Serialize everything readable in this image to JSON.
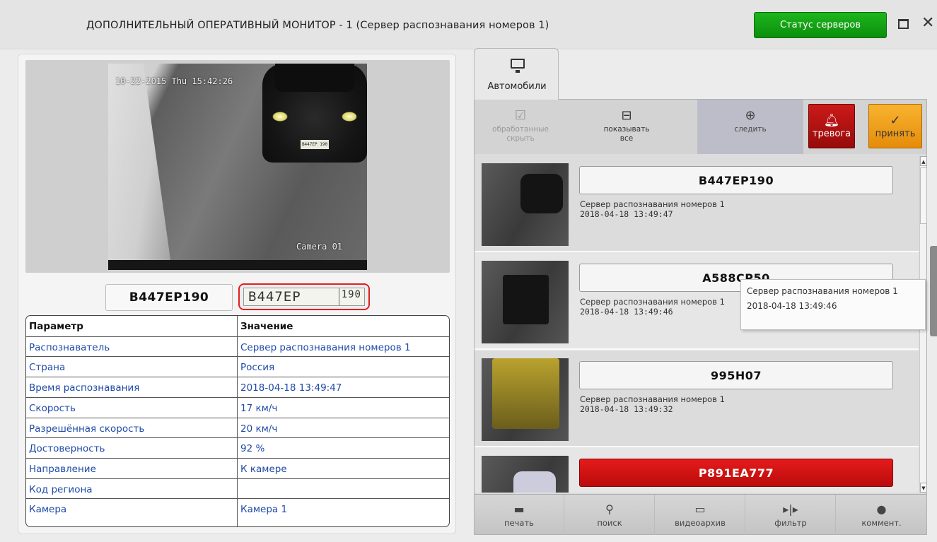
{
  "window": {
    "title": "ДОПОЛНИТЕЛЬНЫЙ ОПЕРАТИВНЫЙ МОНИТОР - 1  (Сервер распознавания номеров 1)",
    "status_button": "Статус серверов",
    "status_color": "#13a313"
  },
  "camera": {
    "timestamp": "10-22-2015 Thu 15:42:26",
    "label": "Camera 01",
    "car_plate_small": "B447EP 190"
  },
  "recognized": {
    "plate_text": "B447EP190",
    "plate_image_main": "B447EP",
    "plate_image_region": "190"
  },
  "params": {
    "header": {
      "param": "Параметр",
      "value": "Значение"
    },
    "rows": [
      {
        "param": "Распознаватель",
        "value": "Сервер распознавания номеров 1"
      },
      {
        "param": "Страна",
        "value": "Россия"
      },
      {
        "param": "Время распознавания",
        "value": "2018-04-18 13:49:47"
      },
      {
        "param": "Скорость",
        "value": "17 км/ч"
      },
      {
        "param": "Разрешённая скорость",
        "value": "20 км/ч"
      },
      {
        "param": "Достоверность",
        "value": "92 %"
      },
      {
        "param": "Направление",
        "value": "К камере"
      },
      {
        "param": "Код региона",
        "value": ""
      },
      {
        "param": "Камера",
        "value": "Камера 1"
      }
    ]
  },
  "tab": {
    "label": "Автомобили",
    "icon": "monitor-icon"
  },
  "toolbar": {
    "hide_processed": {
      "line1": "обработанные",
      "line2": "скрыть",
      "icon": "checked-list-icon"
    },
    "show_all": {
      "line1": "показывать",
      "line2": "все",
      "icon": "layout-icon"
    },
    "watch": {
      "label": "следить",
      "icon": "target-icon"
    },
    "alarm": {
      "label": "тревога",
      "icon": "bell-icon",
      "color": "#b81111"
    },
    "accept": {
      "label": "принять",
      "icon": "checkmark-icon",
      "color": "#f0a020"
    }
  },
  "list": [
    {
      "plate": "B447EP190",
      "server": "Сервер распознавания номеров 1",
      "time": "2018-04-18 13:49:47",
      "alarm": false
    },
    {
      "plate": "A588CP50",
      "server": "Сервер распознавания номеров 1",
      "time": "2018-04-18 13:49:46",
      "alarm": false
    },
    {
      "plate": "995H07",
      "server": "Сервер распознавания номеров 1",
      "time": "2018-04-18 13:49:32",
      "alarm": false
    },
    {
      "plate": "P891EA777",
      "server": "",
      "time": "",
      "alarm": true
    }
  ],
  "tooltip": {
    "line1": "Сервер распознавания номеров 1",
    "line2": "2018-04-18 13:49:46"
  },
  "bottombar": [
    {
      "label": "печать",
      "icon": "printer-icon"
    },
    {
      "label": "поиск",
      "icon": "search-icon"
    },
    {
      "label": "видеоархив",
      "icon": "video-archive-icon"
    },
    {
      "label": "фильтр",
      "icon": "filter-icon"
    },
    {
      "label": "коммент.",
      "icon": "comment-icon"
    }
  ]
}
